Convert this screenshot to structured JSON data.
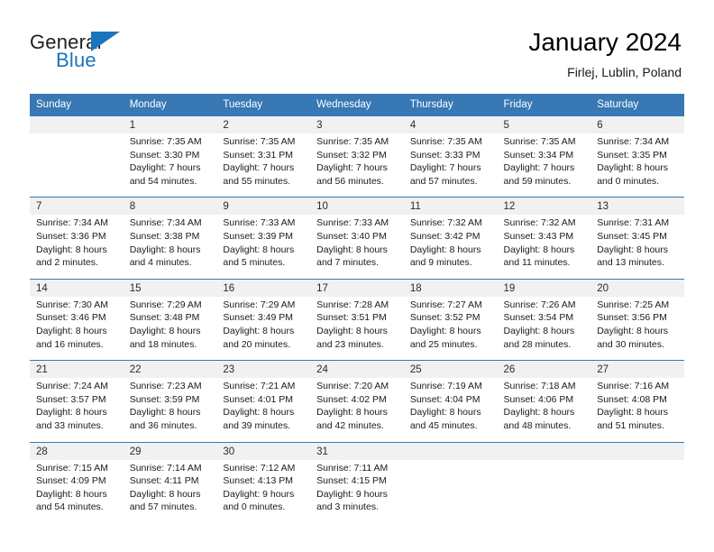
{
  "brand": {
    "name_part1": "General",
    "name_part2": "Blue",
    "triangle_color": "#1b74bb"
  },
  "header": {
    "title": "January 2024",
    "location": "Firlej, Lublin, Poland"
  },
  "colors": {
    "header_bar": "#3878b4",
    "daynum_background": "#f1f1f1",
    "brand_blue": "#1b74bb"
  },
  "weekday_headers": [
    "Sunday",
    "Monday",
    "Tuesday",
    "Wednesday",
    "Thursday",
    "Friday",
    "Saturday"
  ],
  "weeks": [
    [
      {
        "day": "",
        "lines": []
      },
      {
        "day": "1",
        "lines": [
          "Sunrise: 7:35 AM",
          "Sunset: 3:30 PM",
          "Daylight: 7 hours",
          "and 54 minutes."
        ]
      },
      {
        "day": "2",
        "lines": [
          "Sunrise: 7:35 AM",
          "Sunset: 3:31 PM",
          "Daylight: 7 hours",
          "and 55 minutes."
        ]
      },
      {
        "day": "3",
        "lines": [
          "Sunrise: 7:35 AM",
          "Sunset: 3:32 PM",
          "Daylight: 7 hours",
          "and 56 minutes."
        ]
      },
      {
        "day": "4",
        "lines": [
          "Sunrise: 7:35 AM",
          "Sunset: 3:33 PM",
          "Daylight: 7 hours",
          "and 57 minutes."
        ]
      },
      {
        "day": "5",
        "lines": [
          "Sunrise: 7:35 AM",
          "Sunset: 3:34 PM",
          "Daylight: 7 hours",
          "and 59 minutes."
        ]
      },
      {
        "day": "6",
        "lines": [
          "Sunrise: 7:34 AM",
          "Sunset: 3:35 PM",
          "Daylight: 8 hours",
          "and 0 minutes."
        ]
      }
    ],
    [
      {
        "day": "7",
        "lines": [
          "Sunrise: 7:34 AM",
          "Sunset: 3:36 PM",
          "Daylight: 8 hours",
          "and 2 minutes."
        ]
      },
      {
        "day": "8",
        "lines": [
          "Sunrise: 7:34 AM",
          "Sunset: 3:38 PM",
          "Daylight: 8 hours",
          "and 4 minutes."
        ]
      },
      {
        "day": "9",
        "lines": [
          "Sunrise: 7:33 AM",
          "Sunset: 3:39 PM",
          "Daylight: 8 hours",
          "and 5 minutes."
        ]
      },
      {
        "day": "10",
        "lines": [
          "Sunrise: 7:33 AM",
          "Sunset: 3:40 PM",
          "Daylight: 8 hours",
          "and 7 minutes."
        ]
      },
      {
        "day": "11",
        "lines": [
          "Sunrise: 7:32 AM",
          "Sunset: 3:42 PM",
          "Daylight: 8 hours",
          "and 9 minutes."
        ]
      },
      {
        "day": "12",
        "lines": [
          "Sunrise: 7:32 AM",
          "Sunset: 3:43 PM",
          "Daylight: 8 hours",
          "and 11 minutes."
        ]
      },
      {
        "day": "13",
        "lines": [
          "Sunrise: 7:31 AM",
          "Sunset: 3:45 PM",
          "Daylight: 8 hours",
          "and 13 minutes."
        ]
      }
    ],
    [
      {
        "day": "14",
        "lines": [
          "Sunrise: 7:30 AM",
          "Sunset: 3:46 PM",
          "Daylight: 8 hours",
          "and 16 minutes."
        ]
      },
      {
        "day": "15",
        "lines": [
          "Sunrise: 7:29 AM",
          "Sunset: 3:48 PM",
          "Daylight: 8 hours",
          "and 18 minutes."
        ]
      },
      {
        "day": "16",
        "lines": [
          "Sunrise: 7:29 AM",
          "Sunset: 3:49 PM",
          "Daylight: 8 hours",
          "and 20 minutes."
        ]
      },
      {
        "day": "17",
        "lines": [
          "Sunrise: 7:28 AM",
          "Sunset: 3:51 PM",
          "Daylight: 8 hours",
          "and 23 minutes."
        ]
      },
      {
        "day": "18",
        "lines": [
          "Sunrise: 7:27 AM",
          "Sunset: 3:52 PM",
          "Daylight: 8 hours",
          "and 25 minutes."
        ]
      },
      {
        "day": "19",
        "lines": [
          "Sunrise: 7:26 AM",
          "Sunset: 3:54 PM",
          "Daylight: 8 hours",
          "and 28 minutes."
        ]
      },
      {
        "day": "20",
        "lines": [
          "Sunrise: 7:25 AM",
          "Sunset: 3:56 PM",
          "Daylight: 8 hours",
          "and 30 minutes."
        ]
      }
    ],
    [
      {
        "day": "21",
        "lines": [
          "Sunrise: 7:24 AM",
          "Sunset: 3:57 PM",
          "Daylight: 8 hours",
          "and 33 minutes."
        ]
      },
      {
        "day": "22",
        "lines": [
          "Sunrise: 7:23 AM",
          "Sunset: 3:59 PM",
          "Daylight: 8 hours",
          "and 36 minutes."
        ]
      },
      {
        "day": "23",
        "lines": [
          "Sunrise: 7:21 AM",
          "Sunset: 4:01 PM",
          "Daylight: 8 hours",
          "and 39 minutes."
        ]
      },
      {
        "day": "24",
        "lines": [
          "Sunrise: 7:20 AM",
          "Sunset: 4:02 PM",
          "Daylight: 8 hours",
          "and 42 minutes."
        ]
      },
      {
        "day": "25",
        "lines": [
          "Sunrise: 7:19 AM",
          "Sunset: 4:04 PM",
          "Daylight: 8 hours",
          "and 45 minutes."
        ]
      },
      {
        "day": "26",
        "lines": [
          "Sunrise: 7:18 AM",
          "Sunset: 4:06 PM",
          "Daylight: 8 hours",
          "and 48 minutes."
        ]
      },
      {
        "day": "27",
        "lines": [
          "Sunrise: 7:16 AM",
          "Sunset: 4:08 PM",
          "Daylight: 8 hours",
          "and 51 minutes."
        ]
      }
    ],
    [
      {
        "day": "28",
        "lines": [
          "Sunrise: 7:15 AM",
          "Sunset: 4:09 PM",
          "Daylight: 8 hours",
          "and 54 minutes."
        ]
      },
      {
        "day": "29",
        "lines": [
          "Sunrise: 7:14 AM",
          "Sunset: 4:11 PM",
          "Daylight: 8 hours",
          "and 57 minutes."
        ]
      },
      {
        "day": "30",
        "lines": [
          "Sunrise: 7:12 AM",
          "Sunset: 4:13 PM",
          "Daylight: 9 hours",
          "and 0 minutes."
        ]
      },
      {
        "day": "31",
        "lines": [
          "Sunrise: 7:11 AM",
          "Sunset: 4:15 PM",
          "Daylight: 9 hours",
          "and 3 minutes."
        ]
      },
      {
        "day": "",
        "lines": []
      },
      {
        "day": "",
        "lines": []
      },
      {
        "day": "",
        "lines": []
      }
    ]
  ]
}
